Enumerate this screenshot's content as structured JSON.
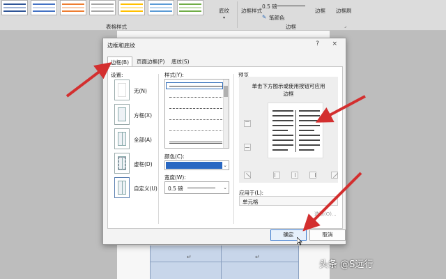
{
  "ribbon": {
    "table_styles_label": "表格样式",
    "shading_label": "底纹",
    "border_styles_label": "边框样式",
    "border_width_value": "0.5 磅",
    "pen_color_label": "笔颜色",
    "borders_button_label": "边框",
    "border_painter_label": "边框刷",
    "borders_group_label": "边框",
    "accent_colors": [
      "#2f5597",
      "#ed7d31",
      "#a5a5a5",
      "#ffc000",
      "#4472c4",
      "#70ad47"
    ]
  },
  "dialog": {
    "title": "边框和底纹",
    "help": "?",
    "close": "×",
    "tabs": [
      {
        "label": "边框(B)",
        "active": true
      },
      {
        "label": "页面边框(P)",
        "active": false
      },
      {
        "label": "底纹(S)",
        "active": false
      }
    ],
    "settings_label": "设置:",
    "settings": [
      {
        "label": "无(N)",
        "kind": "none"
      },
      {
        "label": "方框(X)",
        "kind": "box"
      },
      {
        "label": "全部(A)",
        "kind": "all"
      },
      {
        "label": "虚框(D)",
        "kind": "grid"
      },
      {
        "label": "自定义(U)",
        "kind": "custom",
        "selected": true
      }
    ],
    "style_label": "样式(Y):",
    "color_label": "颜色(C):",
    "color_value": "#2a68c2",
    "width_label": "宽度(W):",
    "width_value": "0.5 磅",
    "preview_label": "预览",
    "preview_hint_line1": "单击下方图示或使用按钮可应用",
    "preview_hint_line2": "边框",
    "apply_to_label": "应用于(L):",
    "apply_to_value": "单元格",
    "options_button": "选项(O)...",
    "ok_button": "确定",
    "cancel_button": "取消"
  },
  "watermark": "头条 @S远行",
  "annotation_color": "#d32f2f"
}
